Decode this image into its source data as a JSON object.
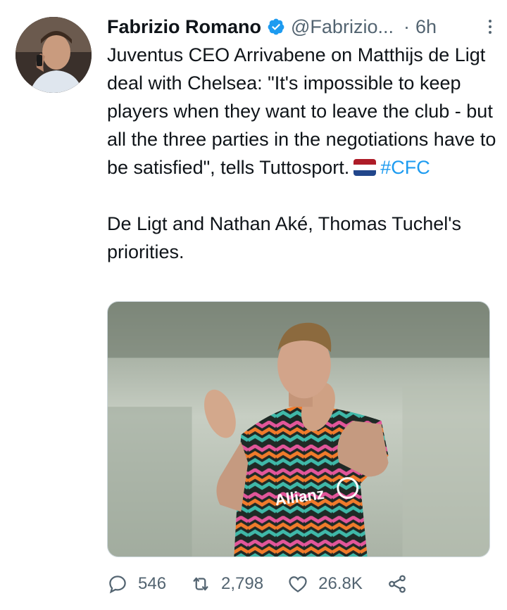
{
  "author": {
    "display_name": "Fabrizio Romano",
    "handle": "@Fabrizio...",
    "separator": "·",
    "time": "6h"
  },
  "tweet": {
    "line1": "Juventus CEO Arrivabene on Matthijs de Ligt deal with Chelsea: \"It's impossible to keep players when they want to leave the club - but all the three parties in the negotiations have to be satisfied\", tells Tuttosport.",
    "hashtag": "#CFC",
    "paragraph2": "De Ligt and Nathan Aké, Thomas Tuchel's priorities."
  },
  "flag": {
    "colors": [
      "#ae1c28",
      "#ffffff",
      "#21468b"
    ]
  },
  "actions": {
    "replies": "546",
    "retweets": "2,798",
    "likes": "26.8K"
  },
  "colors": {
    "accent": "#1d9bf0",
    "secondary_text": "#536471",
    "primary_text": "#0f1419"
  },
  "icons": {
    "verified": "verified-badge-icon",
    "more": "more-options-icon",
    "reply": "reply-icon",
    "retweet": "retweet-icon",
    "like": "heart-icon",
    "share": "share-icon"
  }
}
